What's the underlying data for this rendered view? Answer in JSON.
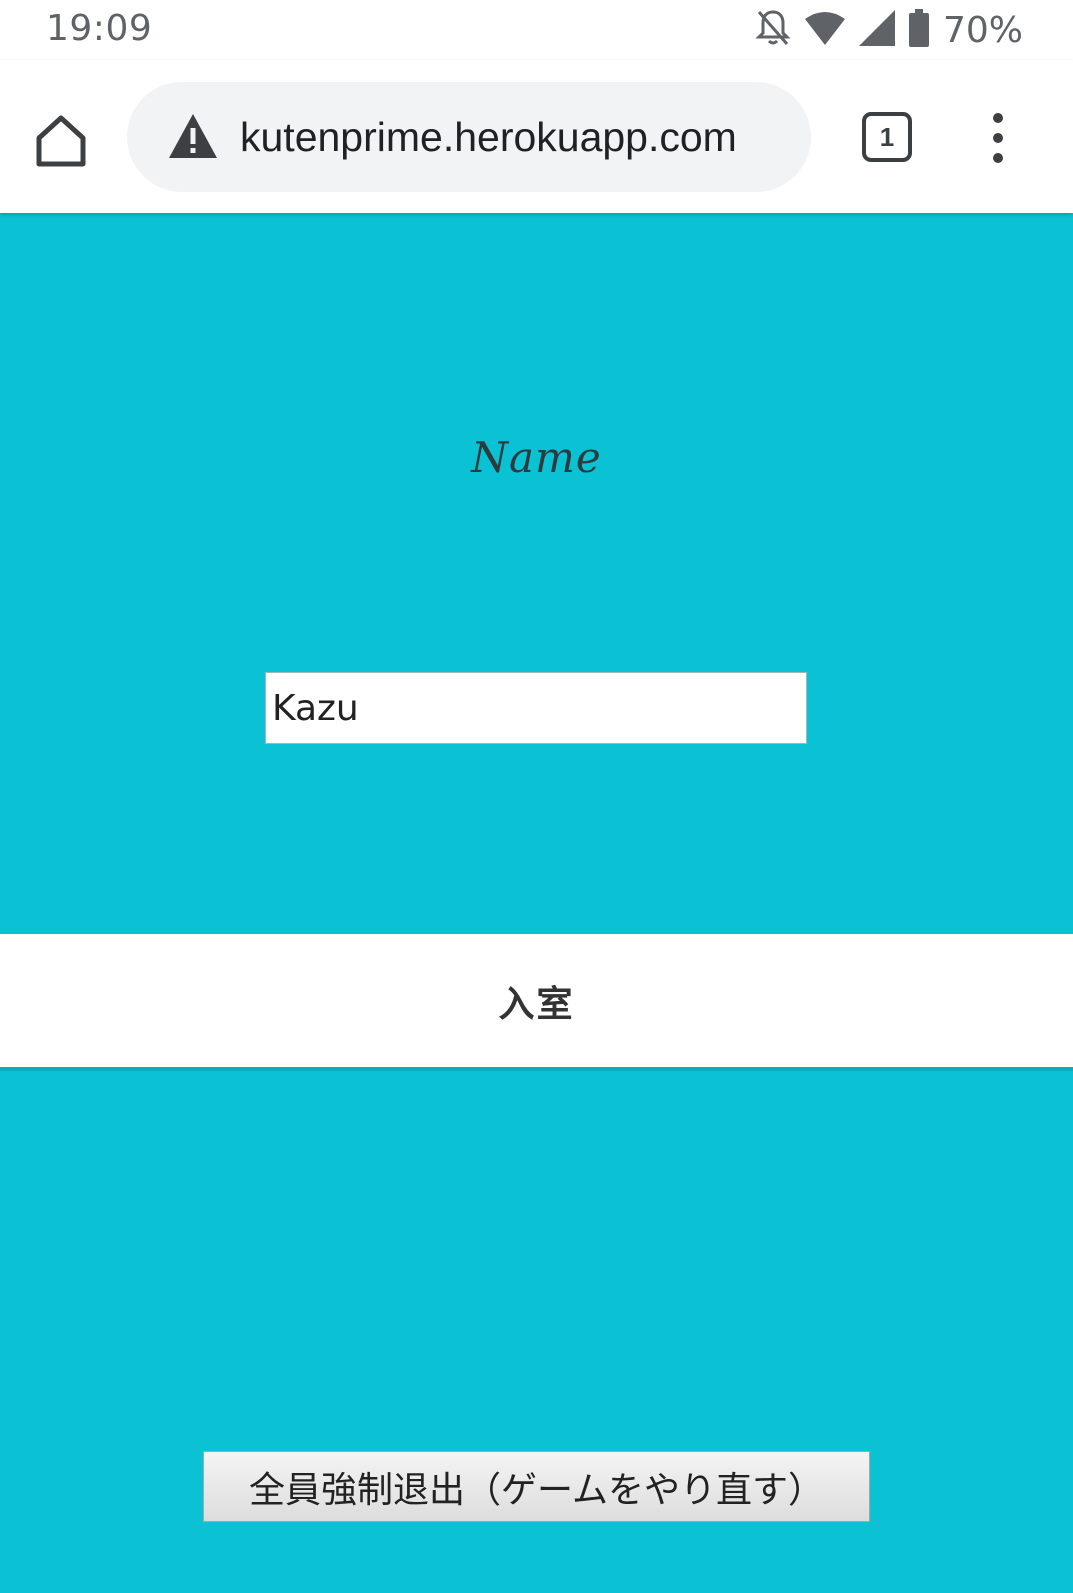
{
  "status_bar": {
    "time": "19:09",
    "battery": "70%",
    "icons": [
      "notifications-off-icon",
      "wifi-icon",
      "cell-signal-icon",
      "battery-icon"
    ]
  },
  "browser": {
    "url": "kutenprime.herokuapp.com",
    "tab_count": "1",
    "icons": [
      "home-icon",
      "not-secure-warning-icon",
      "tab-switcher-icon",
      "more-vert-icon"
    ]
  },
  "form": {
    "name_label": "Name",
    "name_value": "Kazu",
    "enter_label": "入室"
  },
  "reset_button": {
    "label": "全員強制退出（ゲームをやり直す）"
  },
  "colors": {
    "page_background": "#0bc2d4",
    "band_background": "#ffffff"
  }
}
